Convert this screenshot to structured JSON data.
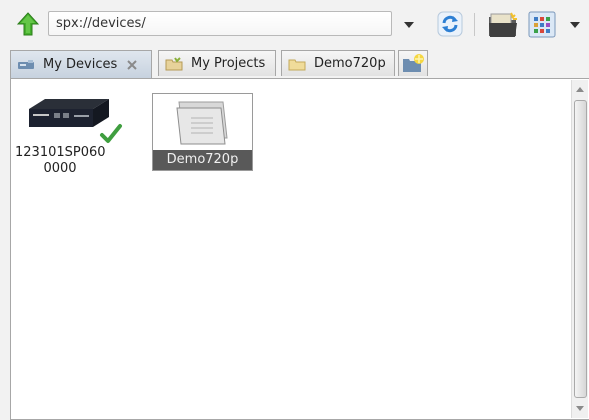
{
  "toolbar": {
    "address_value": "spx://devices/",
    "icons": {
      "up": "green-up-arrow-icon",
      "refresh": "refresh-icon",
      "folder": "folder-icon",
      "view": "grid-view-icon",
      "dropdown": "chevron-down-icon"
    }
  },
  "tabs": [
    {
      "label": "My Devices",
      "icon": "devices-icon",
      "active": true
    },
    {
      "label": "My Projects",
      "icon": "projects-icon",
      "active": false
    },
    {
      "label": "Demo720p",
      "icon": "folder-icon",
      "active": false
    }
  ],
  "items": [
    {
      "label_line1": "123101SP060",
      "label_line2": "0000",
      "icon": "network-device-icon",
      "status": "online",
      "selected": false
    },
    {
      "label": "Demo720p",
      "icon": "folder-icon",
      "selected": true
    }
  ],
  "colors": {
    "selection": "#595959",
    "check": "#3f9e3f",
    "arrow_green": "#3fae2a",
    "refresh_blue": "#2d7fd3"
  }
}
